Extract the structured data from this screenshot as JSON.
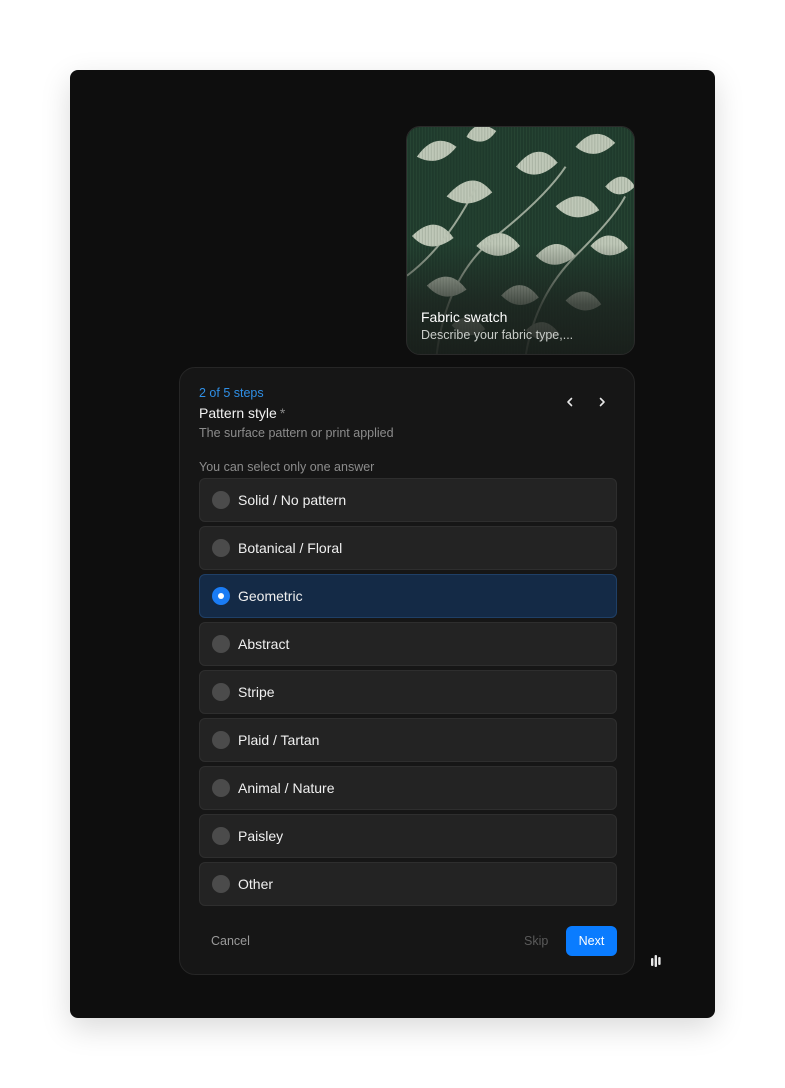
{
  "swatch": {
    "title": "Fabric swatch",
    "subtitle": "Describe your fabric type,..."
  },
  "question": {
    "steps": "2 of 5 steps",
    "title": "Pattern style",
    "required_mark": "*",
    "description": "The surface pattern or print applied",
    "hint": "You can select only one answer",
    "selected_index": 2,
    "options": [
      {
        "label": "Solid / No pattern"
      },
      {
        "label": "Botanical / Floral"
      },
      {
        "label": "Geometric"
      },
      {
        "label": "Abstract"
      },
      {
        "label": "Stripe"
      },
      {
        "label": "Plaid / Tartan"
      },
      {
        "label": "Animal / Nature"
      },
      {
        "label": "Paisley"
      },
      {
        "label": "Other"
      }
    ]
  },
  "nav": {
    "prev_icon": "chevron-left-icon",
    "next_icon": "chevron-right-icon"
  },
  "footer": {
    "cancel_label": "Cancel",
    "skip_label": "Skip",
    "next_label": "Next"
  },
  "colors": {
    "accent": "#0a7cff",
    "steps_text": "#2f8fe6",
    "selected_bg": "#142a46",
    "panel_bg": "#161616",
    "app_bg": "#0e0e0e"
  }
}
